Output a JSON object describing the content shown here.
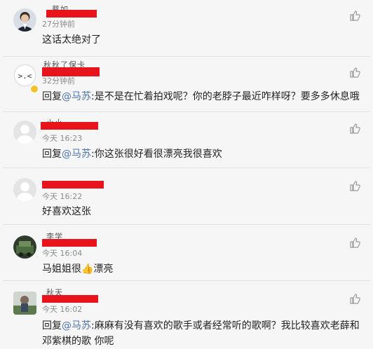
{
  "comments": [
    {
      "name_fragment": "蔡如",
      "time": "27分钟前",
      "text": "这话太绝对了"
    },
    {
      "name_fragment": "秋秋了保卡",
      "time": "32分钟前",
      "reply_prefix": "回复",
      "mention": "@马苏",
      "text": ":是不是在忙着拍戏呢？你的老脖子最近咋样呀？要多多休息哦"
    },
    {
      "name_fragment": "小小",
      "time": "今天 16:23",
      "reply_prefix": "回复",
      "mention": "@马苏",
      "text": ":你这张很好看很漂亮我很喜欢"
    },
    {
      "name_fragment": "",
      "time": "今天 16:22",
      "text": "好喜欢这张"
    },
    {
      "name_fragment": "李学",
      "time": "今天 16:04",
      "text": "马姐姐很👍漂亮"
    },
    {
      "name_fragment": "秋天",
      "time": "今天 16:02",
      "reply_prefix": "回复",
      "mention": "@马苏",
      "text": ":麻麻有没有喜欢的歌手或者经常听的歌啊？我比较喜欢老薛和",
      "text_line2": "邓紫棋的歌 你呢"
    }
  ],
  "icons": {
    "like": "thumbs-up-icon"
  },
  "colors": {
    "redaction": "#e8131b",
    "mention": "#4a73b8",
    "time": "#8c8c8c"
  }
}
